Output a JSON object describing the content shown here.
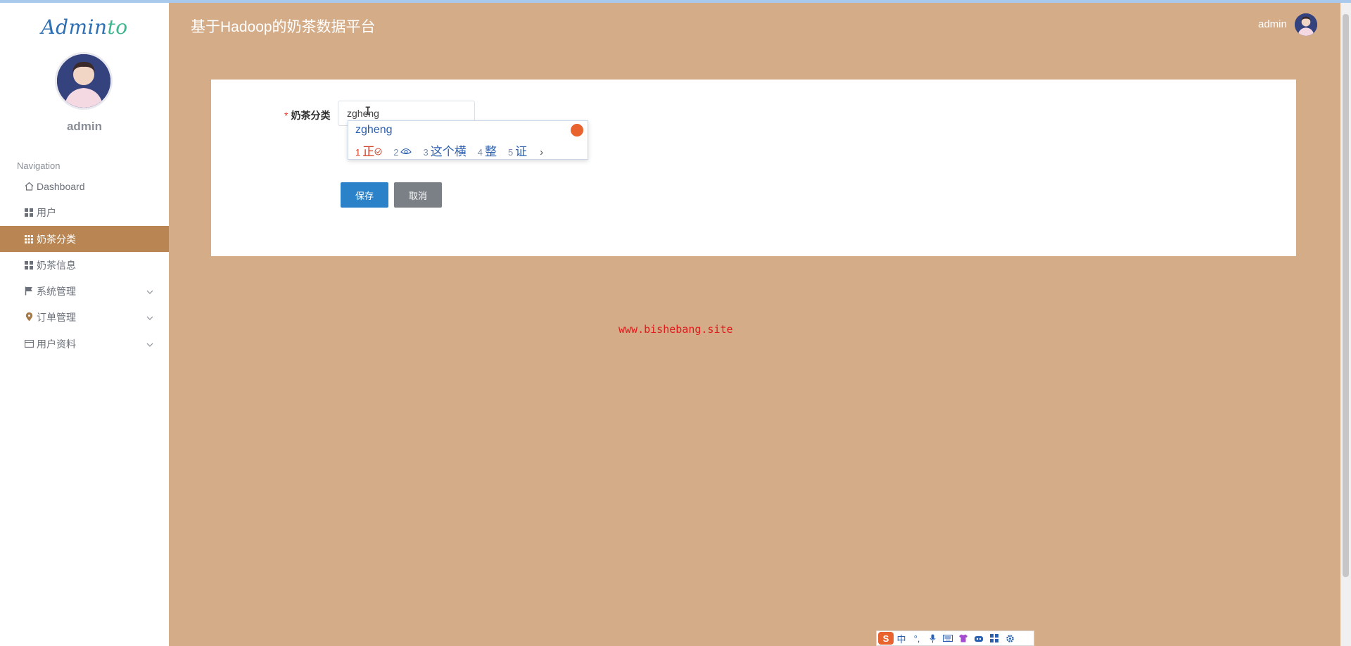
{
  "app": {
    "title": "基于Hadoop的奶茶数据平台",
    "logo_part1": "Admin",
    "logo_part2": "to"
  },
  "sidebar": {
    "username": "admin",
    "nav_title": "Navigation",
    "items": [
      {
        "label": "Dashboard",
        "icon": "home-icon",
        "active": false,
        "expandable": false
      },
      {
        "label": "用户",
        "icon": "grid-icon",
        "active": false,
        "expandable": false
      },
      {
        "label": "奶茶分类",
        "icon": "apps-icon",
        "active": true,
        "expandable": false
      },
      {
        "label": "奶茶信息",
        "icon": "grid-icon",
        "active": false,
        "expandable": false
      },
      {
        "label": "系统管理",
        "icon": "flag-icon",
        "active": false,
        "expandable": true
      },
      {
        "label": "订单管理",
        "icon": "map-pin-icon",
        "active": false,
        "expandable": true
      },
      {
        "label": "用户资料",
        "icon": "card-icon",
        "active": false,
        "expandable": true
      }
    ]
  },
  "header": {
    "username": "admin"
  },
  "form": {
    "required_mark": "*",
    "field_label": "奶茶分类",
    "field_value": "zgheng",
    "save_label": "保存",
    "cancel_label": "取消"
  },
  "ime": {
    "composition": "zgheng",
    "candidates": [
      {
        "num": "1",
        "text": "正"
      },
      {
        "num": "2",
        "text": ""
      },
      {
        "num": "3",
        "text": "这个横"
      },
      {
        "num": "4",
        "text": "整"
      },
      {
        "num": "5",
        "text": "证"
      }
    ],
    "next": "›",
    "toolbar_items": [
      "S",
      "中",
      "°,",
      "mic-icon",
      "keyboard-icon",
      "shirt-icon",
      "robot-icon",
      "grid-icon",
      "gear-icon"
    ]
  },
  "watermark": "www.bishebang.site",
  "colors": {
    "background": "#d4ac88",
    "active_nav": "#b98653",
    "save_button": "#2b82c9",
    "cancel_button": "#7b8087",
    "watermark": "#e01b1b"
  }
}
